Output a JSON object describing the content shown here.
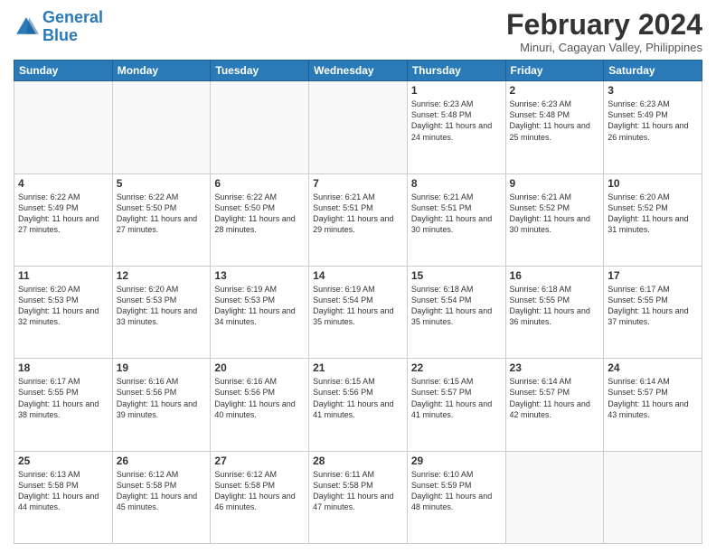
{
  "header": {
    "logo_general": "General",
    "logo_blue": "Blue",
    "month_year": "February 2024",
    "location": "Minuri, Cagayan Valley, Philippines"
  },
  "weekdays": [
    "Sunday",
    "Monday",
    "Tuesday",
    "Wednesday",
    "Thursday",
    "Friday",
    "Saturday"
  ],
  "weeks": [
    [
      {
        "num": "",
        "info": ""
      },
      {
        "num": "",
        "info": ""
      },
      {
        "num": "",
        "info": ""
      },
      {
        "num": "",
        "info": ""
      },
      {
        "num": "1",
        "info": "Sunrise: 6:23 AM\nSunset: 5:48 PM\nDaylight: 11 hours\nand 24 minutes."
      },
      {
        "num": "2",
        "info": "Sunrise: 6:23 AM\nSunset: 5:48 PM\nDaylight: 11 hours\nand 25 minutes."
      },
      {
        "num": "3",
        "info": "Sunrise: 6:23 AM\nSunset: 5:49 PM\nDaylight: 11 hours\nand 26 minutes."
      }
    ],
    [
      {
        "num": "4",
        "info": "Sunrise: 6:22 AM\nSunset: 5:49 PM\nDaylight: 11 hours\nand 27 minutes."
      },
      {
        "num": "5",
        "info": "Sunrise: 6:22 AM\nSunset: 5:50 PM\nDaylight: 11 hours\nand 27 minutes."
      },
      {
        "num": "6",
        "info": "Sunrise: 6:22 AM\nSunset: 5:50 PM\nDaylight: 11 hours\nand 28 minutes."
      },
      {
        "num": "7",
        "info": "Sunrise: 6:21 AM\nSunset: 5:51 PM\nDaylight: 11 hours\nand 29 minutes."
      },
      {
        "num": "8",
        "info": "Sunrise: 6:21 AM\nSunset: 5:51 PM\nDaylight: 11 hours\nand 30 minutes."
      },
      {
        "num": "9",
        "info": "Sunrise: 6:21 AM\nSunset: 5:52 PM\nDaylight: 11 hours\nand 30 minutes."
      },
      {
        "num": "10",
        "info": "Sunrise: 6:20 AM\nSunset: 5:52 PM\nDaylight: 11 hours\nand 31 minutes."
      }
    ],
    [
      {
        "num": "11",
        "info": "Sunrise: 6:20 AM\nSunset: 5:53 PM\nDaylight: 11 hours\nand 32 minutes."
      },
      {
        "num": "12",
        "info": "Sunrise: 6:20 AM\nSunset: 5:53 PM\nDaylight: 11 hours\nand 33 minutes."
      },
      {
        "num": "13",
        "info": "Sunrise: 6:19 AM\nSunset: 5:53 PM\nDaylight: 11 hours\nand 34 minutes."
      },
      {
        "num": "14",
        "info": "Sunrise: 6:19 AM\nSunset: 5:54 PM\nDaylight: 11 hours\nand 35 minutes."
      },
      {
        "num": "15",
        "info": "Sunrise: 6:18 AM\nSunset: 5:54 PM\nDaylight: 11 hours\nand 35 minutes."
      },
      {
        "num": "16",
        "info": "Sunrise: 6:18 AM\nSunset: 5:55 PM\nDaylight: 11 hours\nand 36 minutes."
      },
      {
        "num": "17",
        "info": "Sunrise: 6:17 AM\nSunset: 5:55 PM\nDaylight: 11 hours\nand 37 minutes."
      }
    ],
    [
      {
        "num": "18",
        "info": "Sunrise: 6:17 AM\nSunset: 5:55 PM\nDaylight: 11 hours\nand 38 minutes."
      },
      {
        "num": "19",
        "info": "Sunrise: 6:16 AM\nSunset: 5:56 PM\nDaylight: 11 hours\nand 39 minutes."
      },
      {
        "num": "20",
        "info": "Sunrise: 6:16 AM\nSunset: 5:56 PM\nDaylight: 11 hours\nand 40 minutes."
      },
      {
        "num": "21",
        "info": "Sunrise: 6:15 AM\nSunset: 5:56 PM\nDaylight: 11 hours\nand 41 minutes."
      },
      {
        "num": "22",
        "info": "Sunrise: 6:15 AM\nSunset: 5:57 PM\nDaylight: 11 hours\nand 41 minutes."
      },
      {
        "num": "23",
        "info": "Sunrise: 6:14 AM\nSunset: 5:57 PM\nDaylight: 11 hours\nand 42 minutes."
      },
      {
        "num": "24",
        "info": "Sunrise: 6:14 AM\nSunset: 5:57 PM\nDaylight: 11 hours\nand 43 minutes."
      }
    ],
    [
      {
        "num": "25",
        "info": "Sunrise: 6:13 AM\nSunset: 5:58 PM\nDaylight: 11 hours\nand 44 minutes."
      },
      {
        "num": "26",
        "info": "Sunrise: 6:12 AM\nSunset: 5:58 PM\nDaylight: 11 hours\nand 45 minutes."
      },
      {
        "num": "27",
        "info": "Sunrise: 6:12 AM\nSunset: 5:58 PM\nDaylight: 11 hours\nand 46 minutes."
      },
      {
        "num": "28",
        "info": "Sunrise: 6:11 AM\nSunset: 5:58 PM\nDaylight: 11 hours\nand 47 minutes."
      },
      {
        "num": "29",
        "info": "Sunrise: 6:10 AM\nSunset: 5:59 PM\nDaylight: 11 hours\nand 48 minutes."
      },
      {
        "num": "",
        "info": ""
      },
      {
        "num": "",
        "info": ""
      }
    ]
  ]
}
